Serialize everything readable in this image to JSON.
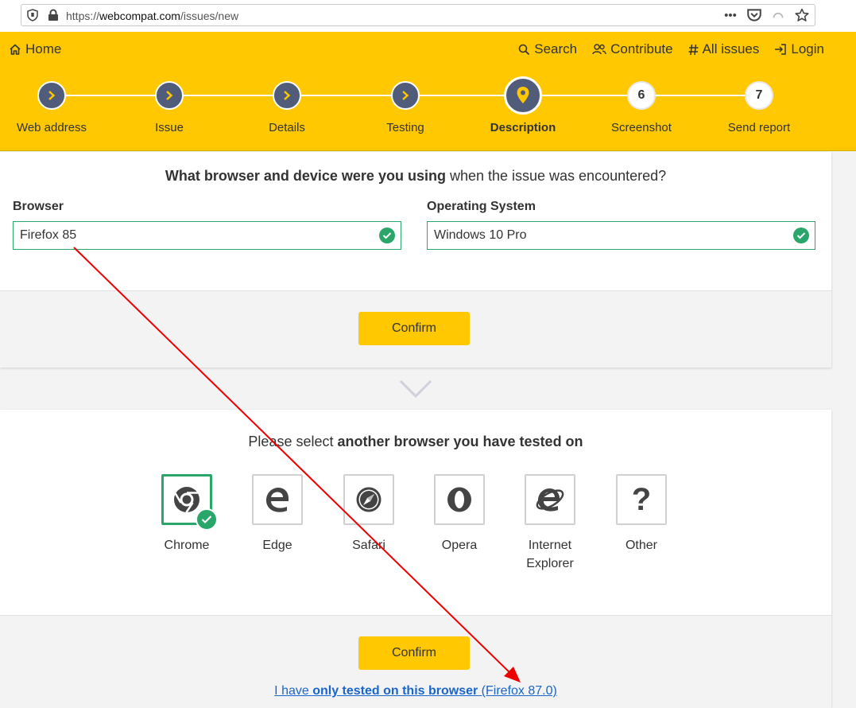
{
  "browser": {
    "url_prefix": "https://",
    "url_host": "webcompat.com",
    "url_path": "/issues/new"
  },
  "nav": {
    "home": "Home",
    "search": "Search",
    "contribute": "Contribute",
    "all_issues": "All issues",
    "login": "Login"
  },
  "steps": [
    {
      "label": "Web address",
      "state": "done"
    },
    {
      "label": "Issue",
      "state": "done"
    },
    {
      "label": "Details",
      "state": "done"
    },
    {
      "label": "Testing",
      "state": "done"
    },
    {
      "label": "Description",
      "state": "current"
    },
    {
      "label": "Screenshot",
      "state": "future",
      "number": "6"
    },
    {
      "label": "Send report",
      "state": "future",
      "number": "7"
    }
  ],
  "device": {
    "question_bold": "What browser and device were you using",
    "question_rest": " when the issue was encountered?",
    "browser_label": "Browser",
    "browser_value": "Firefox 85",
    "os_label": "Operating System",
    "os_value": "Windows 10 Pro",
    "confirm": "Confirm"
  },
  "tested": {
    "question_plain": "Please select ",
    "question_bold": "another browser you have tested on",
    "options": [
      {
        "label": "Chrome",
        "selected": true,
        "icon": "chrome-icon"
      },
      {
        "label": "Edge",
        "selected": false,
        "icon": "edge-icon"
      },
      {
        "label": "Safari",
        "selected": false,
        "icon": "safari-icon"
      },
      {
        "label": "Opera",
        "selected": false,
        "icon": "opera-icon"
      },
      {
        "label": "Internet Explorer",
        "selected": false,
        "icon": "ie-icon"
      },
      {
        "label": "Other",
        "selected": false,
        "icon": "question-icon"
      }
    ],
    "confirm": "Confirm",
    "only_prefix": "I have ",
    "only_bold": "only tested on this browser",
    "only_suffix": " (Firefox 87.0)"
  },
  "colors": {
    "header": "#ffc800",
    "step_done": "#515c7a",
    "success": "#2aa66b",
    "link": "#1a65c9",
    "annotation_arrow": "#ee0000"
  }
}
